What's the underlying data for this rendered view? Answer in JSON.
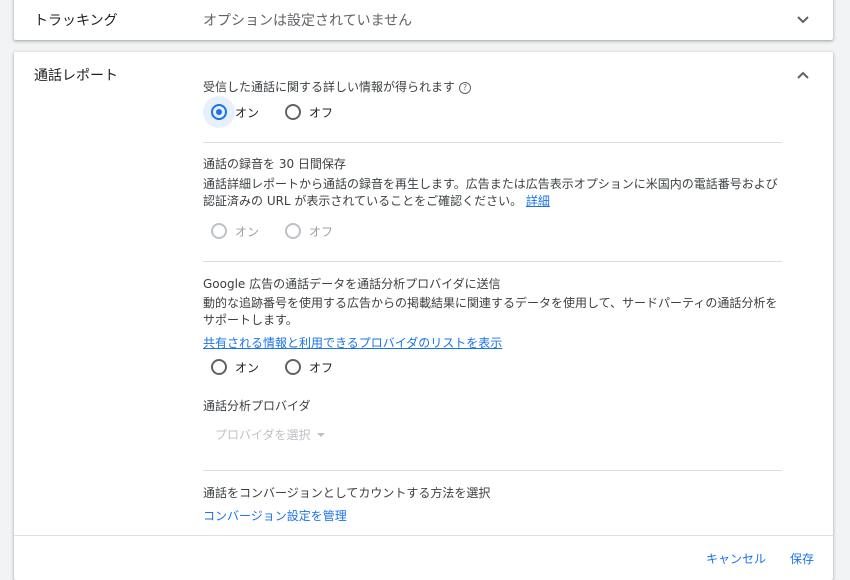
{
  "tracking": {
    "title": "トラッキング",
    "summary": "オプションは設定されていません"
  },
  "calls": {
    "title": "通話レポート",
    "detailed_info": {
      "question": "受信した通話に関する詳しい情報が得られます",
      "help_icon": "?",
      "on": "オン",
      "off": "オフ",
      "selected": "オン"
    },
    "recording": {
      "question": "通話の録音を 30 日間保存",
      "desc": "通話詳細レポートから通話の録音を再生します。広告または広告表示オプションに米国内の電話番号および認証済みの URL が表示されていることをご確認ください。",
      "link": "詳細",
      "on": "オン",
      "off": "オフ"
    },
    "analytics": {
      "question": "Google 広告の通話データを通話分析プロバイダに送信",
      "desc": "動的な追跡番号を使用する広告からの掲載結果に関連するデータを使用して、サードパーティの通話分析をサポートします。",
      "link": "共有される情報と利用できるプロバイダのリストを表示",
      "on": "オン",
      "off": "オフ"
    },
    "provider": {
      "label": "通話分析プロバイダ",
      "placeholder": "プロバイダを選択"
    },
    "conversion": {
      "label": "通話をコンバージョンとしてカウントする方法を選択",
      "link": "コンバージョン設定を管理"
    },
    "footer": {
      "cancel": "キャンセル",
      "save": "保存"
    }
  },
  "colors": {
    "accent": "#1a73e8",
    "disabled": "#bdc1c6"
  }
}
